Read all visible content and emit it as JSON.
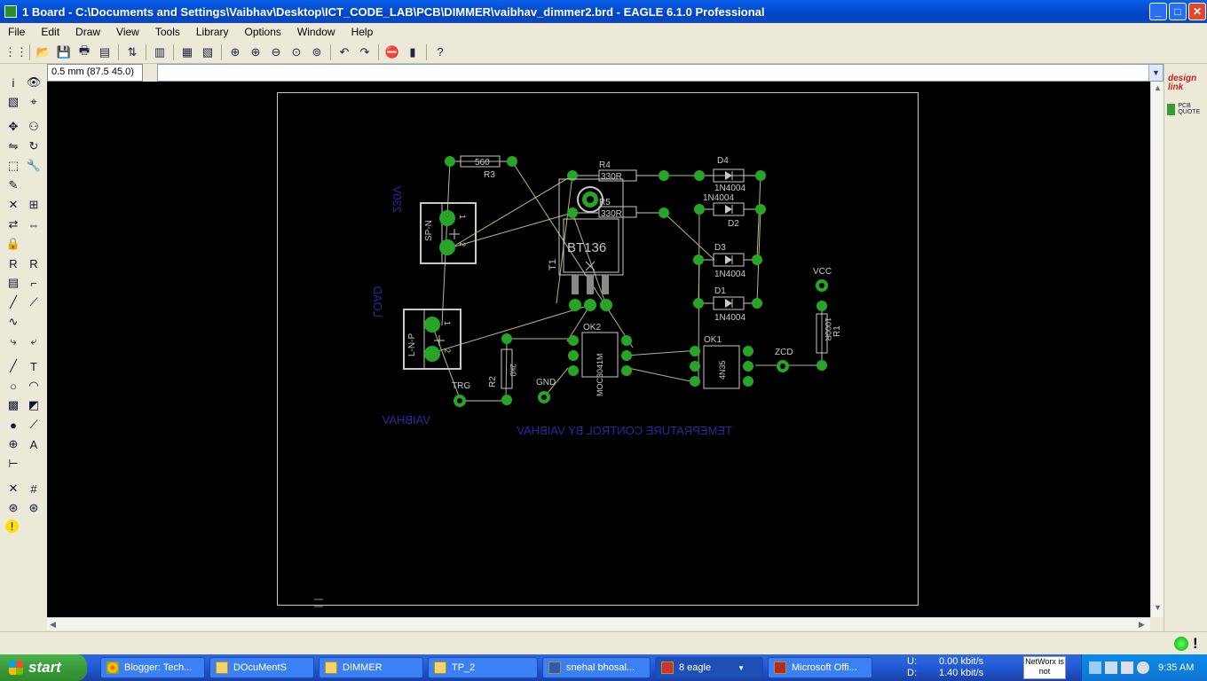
{
  "window": {
    "title": "1 Board - C:\\Documents and Settings\\Vaibhav\\Desktop\\ICT_CODE_LAB\\PCB\\DIMMER\\vaibhav_dimmer2.brd - EAGLE 6.1.0 Professional"
  },
  "menu": [
    "File",
    "Edit",
    "Draw",
    "View",
    "Tools",
    "Library",
    "Options",
    "Window",
    "Help"
  ],
  "coord_readout": "0.5 mm (87.5 45.0)",
  "board": {
    "silk_labels": {
      "r3_value": "560",
      "r3": "R3",
      "r4": "R4",
      "r4_value": "330R",
      "r5": "R5",
      "r5_value": "330R",
      "t1": "T1",
      "t1_value": "BT136",
      "d4": "D4",
      "d4_value": "1N4004",
      "d2_value": "1N4004",
      "d2": "D2",
      "d3": "D3",
      "d3_value": "1N4004",
      "d1": "D1",
      "d1_value": "1N4004",
      "vcc": "VCC",
      "r1": "R1",
      "r1_value": "1000R",
      "ok1": "OK1",
      "ok1_value": "4N35",
      "ok2": "OK2",
      "ok2_value": "MOC3041M",
      "zcd": "ZCD",
      "gnd": "GND",
      "trg": "TRG",
      "r2": "R2",
      "r2_value": "2k0",
      "sp_n": "SP-N",
      "l_n_p": "L-N-P",
      "pin1": "1",
      "pin2": "2"
    },
    "mirrored_texts": {
      "v230": "230V",
      "load": "LOAD",
      "vaibhav": "VAIBHAV",
      "temp": "TEMEPRATURE CONTROL BY VAIBHAV"
    }
  },
  "right_panel": {
    "designlink": "design link",
    "pcbquote": "PCB QUOTE"
  },
  "taskbar": {
    "start": "start",
    "tasks": [
      "Blogger: Tech...",
      "DOcuMentS",
      "DIMMER",
      "TP_2",
      "snehal bhosal...",
      "8 eagle",
      "Microsoft Offi..."
    ],
    "net_u": "U:",
    "net_u_val": "0.00 kbit/s",
    "net_d": "D:",
    "net_d_val": "1.40 kbit/s",
    "networx": "NetWorx is not",
    "clock": "9:35 AM"
  },
  "colors": {
    "canvas": "#000000",
    "pad": "#27a527",
    "silk": "#c8c8c8",
    "docu": "#2a2aa0",
    "airwire": "#c8c878"
  }
}
